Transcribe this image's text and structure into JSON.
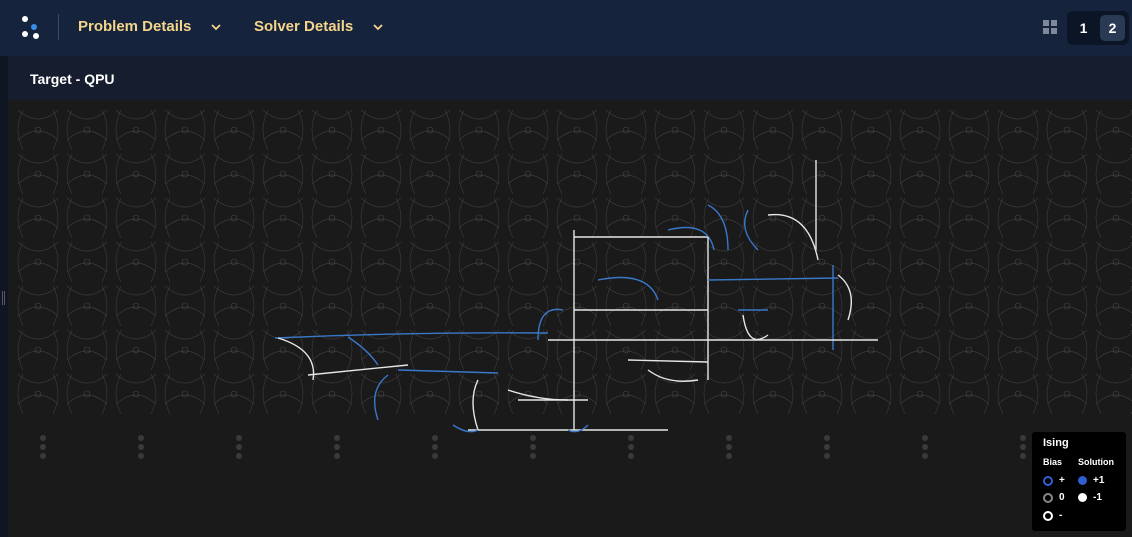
{
  "header": {
    "menus": [
      {
        "label": "Problem Details"
      },
      {
        "label": "Solver Details"
      }
    ],
    "pages": [
      "1",
      "2"
    ],
    "active_page": "2"
  },
  "panel": {
    "title": "Target - QPU"
  },
  "legend": {
    "title": "Ising",
    "bias_header": "Bias",
    "solution_header": "Solution",
    "bias_items": [
      {
        "label": "+",
        "color": "#2f5fd0"
      },
      {
        "label": "0",
        "color": "#888888"
      },
      {
        "label": "-",
        "color": "#ffffff"
      }
    ],
    "solution_items": [
      {
        "label": "+1",
        "color": "#2f5fd0"
      },
      {
        "label": "-1",
        "color": "#ffffff"
      }
    ]
  },
  "colors": {
    "topbar": "#16233d",
    "menu_text": "#f4d58a",
    "spin_up": "#3a78c9",
    "spin_down": "#e6e6e6"
  }
}
